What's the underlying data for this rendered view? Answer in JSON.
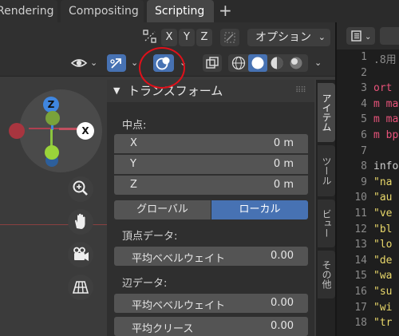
{
  "workspace_tabs": [
    {
      "label": "Rendering"
    },
    {
      "label": "Compositing"
    },
    {
      "label": "Scripting"
    }
  ],
  "add_workspace": "+",
  "viewport_header": {
    "axis_buttons": [
      "X",
      "Y",
      "Z"
    ],
    "options_label": "オプション"
  },
  "gizmo": {
    "z": "Z",
    "x": "X"
  },
  "panel": {
    "title": "トランスフォーム",
    "median_label": "中点:",
    "fields": [
      {
        "label": "X",
        "value": "0 m"
      },
      {
        "label": "Y",
        "value": "0 m"
      },
      {
        "label": "Z",
        "value": "0 m"
      }
    ],
    "global_label": "グローバル",
    "local_label": "ローカル",
    "vertex_data_label": "頂点データ:",
    "vertex_bevel": {
      "label": "平均ベベルウェイト",
      "value": "0.00"
    },
    "edge_data_label": "辺データ:",
    "edge_bevel": {
      "label": "平均ベベルウェイト",
      "value": "0.00"
    },
    "edge_crease": {
      "label": "平均クリース",
      "value": "0.00"
    }
  },
  "side_tabs": [
    "アイテム",
    "ツール",
    "ビュー",
    "その他"
  ],
  "editor": {
    "lines": [
      {
        "num": "1",
        "code": ".8用",
        "color": "#8c8c8c"
      },
      {
        "num": "2",
        "code": "",
        "color": "#d0d0d0"
      },
      {
        "num": "3",
        "code": "ort",
        "color": "#e8537a"
      },
      {
        "num": "4",
        "code": "m ma",
        "color": "#e8537a"
      },
      {
        "num": "5",
        "code": "m ma",
        "color": "#e8537a"
      },
      {
        "num": "6",
        "code": "m bp",
        "color": "#e8537a"
      },
      {
        "num": "7",
        "code": "",
        "color": "#d0d0d0"
      },
      {
        "num": "8",
        "code": "info",
        "color": "#d0d0d0"
      },
      {
        "num": "9",
        "code": "\"na",
        "color": "#e9d86a"
      },
      {
        "num": "10",
        "code": "\"au",
        "color": "#e9d86a"
      },
      {
        "num": "11",
        "code": "\"ve",
        "color": "#e9d86a"
      },
      {
        "num": "12",
        "code": "\"bl",
        "color": "#e9d86a"
      },
      {
        "num": "13",
        "code": "\"lo",
        "color": "#e9d86a"
      },
      {
        "num": "14",
        "code": "\"de",
        "color": "#e9d86a"
      },
      {
        "num": "15",
        "code": "\"wa",
        "color": "#e9d86a"
      },
      {
        "num": "16",
        "code": "\"su",
        "color": "#e9d86a"
      },
      {
        "num": "17",
        "code": "\"wi",
        "color": "#e9d86a"
      },
      {
        "num": "18",
        "code": "\"tr",
        "color": "#e9d86a"
      }
    ]
  },
  "colors": {
    "accent_blue": "#4772b3",
    "axis_x": "#e0455a",
    "axis_y": "#8bc53f",
    "axis_z": "#3f86e0",
    "annotation_red": "#e0101a"
  }
}
